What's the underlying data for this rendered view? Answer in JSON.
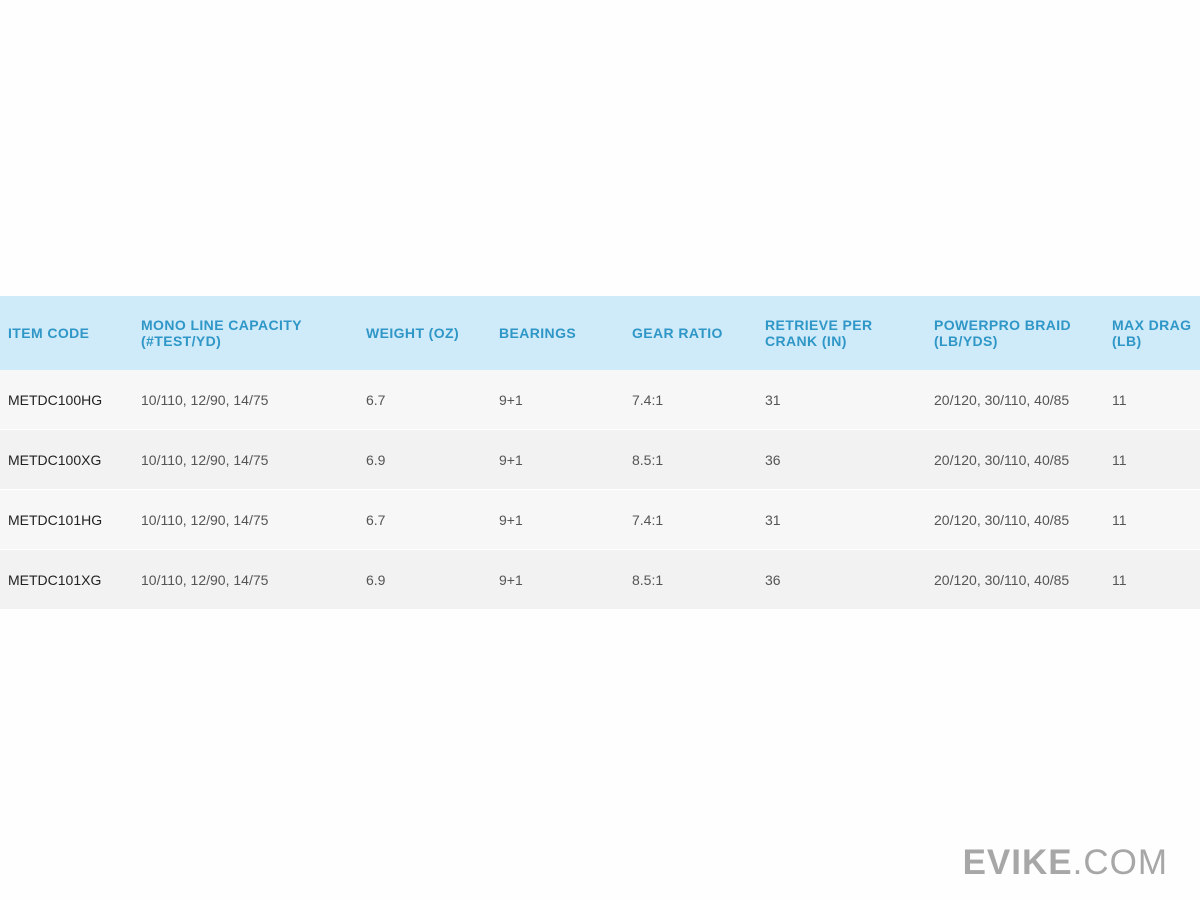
{
  "table": {
    "headers": [
      "ITEM CODE",
      "MONO LINE CAPACITY (#TEST/YD)",
      "WEIGHT (OZ)",
      "BEARINGS",
      "GEAR RATIO",
      "RETRIEVE PER CRANK (IN)",
      "POWERPRO BRAID (LB/YDS)",
      "MAX DRAG (LB)"
    ],
    "rows": [
      [
        "METDC100HG",
        "10/110, 12/90, 14/75",
        "6.7",
        "9+1",
        "7.4:1",
        "31",
        "20/120, 30/110, 40/85",
        "11"
      ],
      [
        "METDC100XG",
        "10/110, 12/90, 14/75",
        "6.9",
        "9+1",
        "8.5:1",
        "36",
        "20/120, 30/110, 40/85",
        "11"
      ],
      [
        "METDC101HG",
        "10/110, 12/90, 14/75",
        "6.7",
        "9+1",
        "7.4:1",
        "31",
        "20/120, 30/110, 40/85",
        "11"
      ],
      [
        "METDC101XG",
        "10/110, 12/90, 14/75",
        "6.9",
        "9+1",
        "8.5:1",
        "36",
        "20/120, 30/110, 40/85",
        "11"
      ]
    ]
  },
  "watermark": {
    "brand": "EVIKE",
    "suffix": ".COM"
  },
  "colors": {
    "header_bg": "#cfeaf8",
    "header_text": "#2f97c7",
    "row_odd": "#f7f7f7",
    "row_even": "#f2f2f2",
    "watermark": "#a7a7a7"
  }
}
